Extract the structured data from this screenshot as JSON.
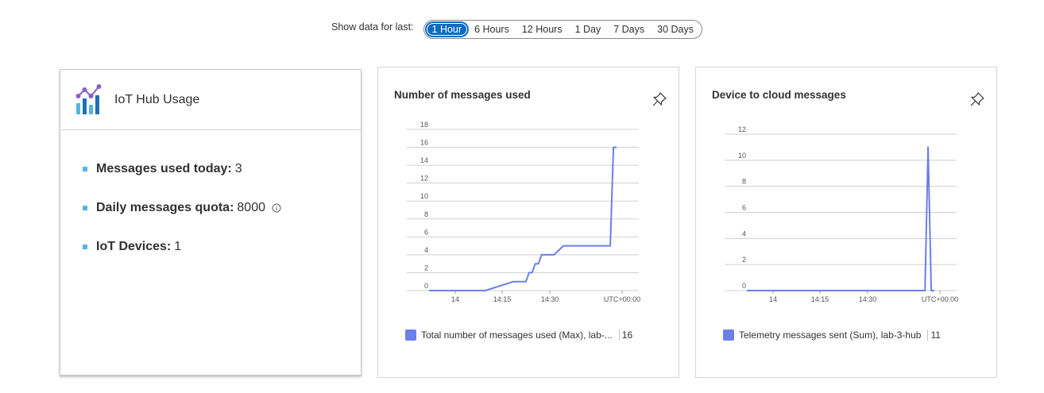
{
  "time_range": {
    "label": "Show data for last:",
    "options": [
      "1 Hour",
      "6 Hours",
      "12 Hours",
      "1 Day",
      "7 Days",
      "30 Days"
    ],
    "selected": "1 Hour"
  },
  "usage": {
    "title": "IoT Hub Usage",
    "items": [
      {
        "key": "Messages used today:",
        "value": "3"
      },
      {
        "key": "Daily messages quota:",
        "value": "8000"
      },
      {
        "key": "IoT Devices:",
        "value": "1"
      }
    ]
  },
  "colors": {
    "accent": "#0f6cbd",
    "series": "#6b7fe8",
    "bullet": "#59b4d9"
  },
  "charts": [
    {
      "title": "Number of messages used",
      "legend_label": "Total number of messages used (Max), lab-...",
      "legend_value": "16"
    },
    {
      "title": "Device to cloud messages",
      "legend_label": "Telemetry messages sent (Sum), lab-3-hub",
      "legend_value": "11"
    }
  ],
  "chart_data": [
    {
      "type": "line",
      "title": "Number of messages used",
      "x_ticks": [
        "14",
        "14:15",
        "14:30",
        "UTC+00:00"
      ],
      "y_ticks": [
        0,
        2,
        4,
        6,
        8,
        10,
        12,
        14,
        16,
        18
      ],
      "ylim": [
        0,
        18
      ],
      "x_domain_minutes": [
        0,
        60
      ],
      "series": [
        {
          "name": "Total number of messages used (Max), lab-...",
          "x": [
            0,
            9,
            18,
            27,
            28,
            29,
            30,
            31,
            32,
            33,
            34,
            35,
            36,
            37,
            40,
            43,
            50,
            57,
            58,
            59,
            60
          ],
          "values": [
            0,
            0,
            0,
            1,
            1,
            1,
            1,
            1,
            2,
            2,
            3,
            3,
            4,
            4,
            4,
            5,
            5,
            5,
            5,
            16,
            16
          ]
        }
      ],
      "grid": true
    },
    {
      "type": "line",
      "title": "Device to cloud messages",
      "x_ticks": [
        "14",
        "14:15",
        "14:30",
        "UTC+00:00"
      ],
      "y_ticks": [
        0,
        2,
        4,
        6,
        8,
        10,
        12
      ],
      "ylim": [
        0,
        12
      ],
      "x_domain_minutes": [
        0,
        60
      ],
      "series": [
        {
          "name": "Telemetry messages sent (Sum), lab-3-hub",
          "x": [
            0,
            10,
            20,
            30,
            40,
            50,
            56,
            57,
            58,
            59,
            60
          ],
          "values": [
            0,
            0,
            0,
            0,
            0,
            0,
            0,
            0,
            11,
            0,
            0
          ]
        }
      ],
      "grid": true
    }
  ]
}
